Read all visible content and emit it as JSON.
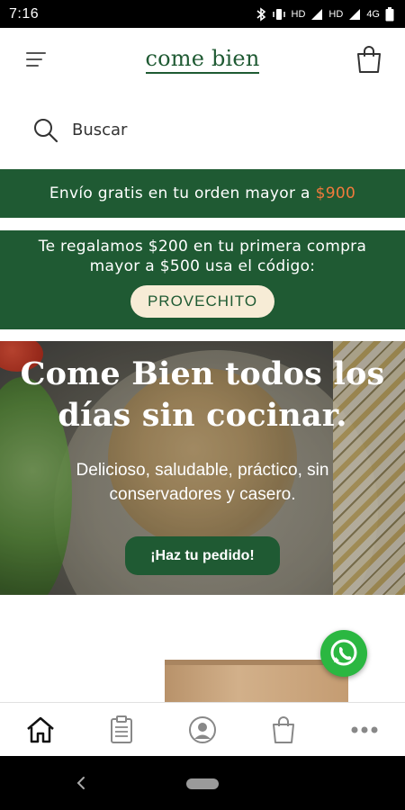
{
  "status_bar": {
    "time": "7:16",
    "network_labels": [
      "HD",
      "HD",
      "4G"
    ]
  },
  "header": {
    "logo_text": "come bien",
    "brand_color": "#1f5a33"
  },
  "search": {
    "placeholder": "Buscar",
    "value": ""
  },
  "shipping_banner": {
    "text": "Envío gratis en tu orden mayor a",
    "price": "$900",
    "price_color": "#f07a3c"
  },
  "promo_banner": {
    "line1": "Te regalamos $200 en tu primera compra",
    "line2": "mayor a $500 usa el código:",
    "code": "PROVECHITO"
  },
  "hero": {
    "title_line1": "Come Bien todos los",
    "title_line2": "días sin cocinar.",
    "subtitle_line1": "Delicioso, saludable, práctico, sin",
    "subtitle_line2": "conservadores y casero.",
    "cta_label": "¡Haz tu pedido!"
  },
  "bottom_nav": {
    "items": [
      {
        "icon": "home-icon",
        "active": true
      },
      {
        "icon": "clipboard-icon",
        "active": false
      },
      {
        "icon": "account-icon",
        "active": false
      },
      {
        "icon": "shopping-bag-icon",
        "active": false
      },
      {
        "icon": "more-icon",
        "active": false
      }
    ]
  },
  "colors": {
    "accent_green": "#1f5a33",
    "promo_pill_bg": "#f7ecd6",
    "whatsapp_green": "#2bb741"
  }
}
